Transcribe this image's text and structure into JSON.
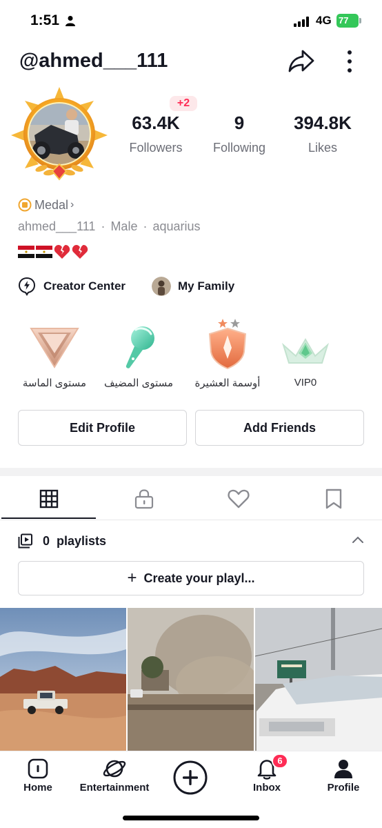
{
  "status_bar": {
    "time": "1:51",
    "network": "4G",
    "battery": "77"
  },
  "header": {
    "username": "@ahmed___111"
  },
  "stats": {
    "new_followers_badge": "+2",
    "followers": {
      "value": "63.4K",
      "label": "Followers"
    },
    "following": {
      "value": "9",
      "label": "Following"
    },
    "likes": {
      "value": "394.8K",
      "label": "Likes"
    }
  },
  "profile": {
    "medal_label": "Medal",
    "handle": "ahmed___111",
    "gender": "Male",
    "zodiac": "aquarius",
    "bio_emoji": [
      "egypt-flag",
      "egypt-flag",
      "broken-heart",
      "broken-heart"
    ]
  },
  "links": {
    "creator_center": "Creator Center",
    "my_family": "My Family"
  },
  "levels": [
    {
      "label": "مستوى الماسة",
      "icon": "diamond-level-icon"
    },
    {
      "label": "مستوى المضيف",
      "icon": "microphone-level-icon"
    },
    {
      "label": "أوسمة العشيرة",
      "icon": "clan-shield-icon"
    },
    {
      "label": "VIP0",
      "icon": "vip-crown-icon"
    }
  ],
  "buttons": {
    "edit_profile": "Edit Profile",
    "add_friends": "Add Friends"
  },
  "tabs": [
    "videos-grid",
    "private",
    "liked",
    "saved"
  ],
  "playlists": {
    "count": "0",
    "label": "playlists",
    "create_label": "Create your playl..."
  },
  "videos": [
    {
      "scene": "desert-pickup-truck"
    },
    {
      "scene": "dusty-road"
    },
    {
      "scene": "white-suv-street"
    }
  ],
  "bottom_nav": {
    "home": "Home",
    "entertainment": "Entertainment",
    "inbox": "Inbox",
    "inbox_badge": "6",
    "profile": "Profile"
  },
  "colors": {
    "accent": "#fe2c55",
    "text": "#161823",
    "muted": "#6b6d76",
    "battery": "#34c759"
  }
}
